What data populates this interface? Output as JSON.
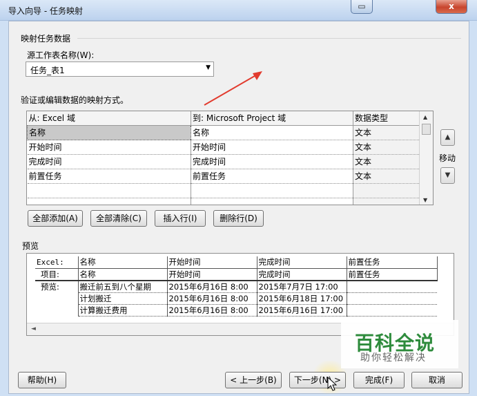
{
  "window": {
    "title": "导入向导 - 任务映射",
    "close_glyph": "x"
  },
  "mapping_section": {
    "title": "映射任务数据",
    "source_label": "源工作表名称(W):",
    "source_value": "任务_表1"
  },
  "grid": {
    "caption": "验证或编辑数据的映射方式。",
    "headers": [
      "从: Excel 域",
      "到: Microsoft Project 域",
      "数据类型"
    ],
    "rows": [
      [
        "名称",
        "名称",
        "文本"
      ],
      [
        "开始时间",
        "开始时间",
        "文本"
      ],
      [
        "完成时间",
        "完成时间",
        "文本"
      ],
      [
        "前置任务",
        "前置任务",
        "文本"
      ],
      [
        "",
        "",
        ""
      ],
      [
        "",
        "",
        ""
      ]
    ],
    "move_label": "移动"
  },
  "buttons": {
    "add_all": "全部添加(A)",
    "clear_all": "全部清除(C)",
    "insert_row": "插入行(I)",
    "delete_row": "删除行(D)",
    "help": "帮助(H)",
    "back": "< 上一步(B)",
    "next": "下一步(N) >",
    "finish": "完成(F)",
    "cancel": "取消"
  },
  "preview": {
    "title": "预览",
    "row_excel": [
      "Excel:",
      "名称",
      "开始时间",
      "完成时间",
      "前置任务"
    ],
    "row_project": [
      "项目:",
      "名称",
      "开始时间",
      "完成时间",
      "前置任务"
    ],
    "preview_label": "预览:",
    "data": [
      [
        "搬迁前五到八个星期",
        "2015年6月16日  8:00",
        "2015年7月7日  17:00",
        ""
      ],
      [
        "计划搬迁",
        "2015年6月16日  8:00",
        "2015年6月18日  17:00",
        ""
      ],
      [
        "计算搬迁费用",
        "2015年6月16日  8:00",
        "2015年6月16日  17:00",
        ""
      ]
    ]
  },
  "watermark": {
    "main": "百科全说",
    "sub": "助你轻松解决"
  },
  "colors": {
    "annotation_arrow": "#e23b2e",
    "watermark_green": "#2e8b3c"
  }
}
